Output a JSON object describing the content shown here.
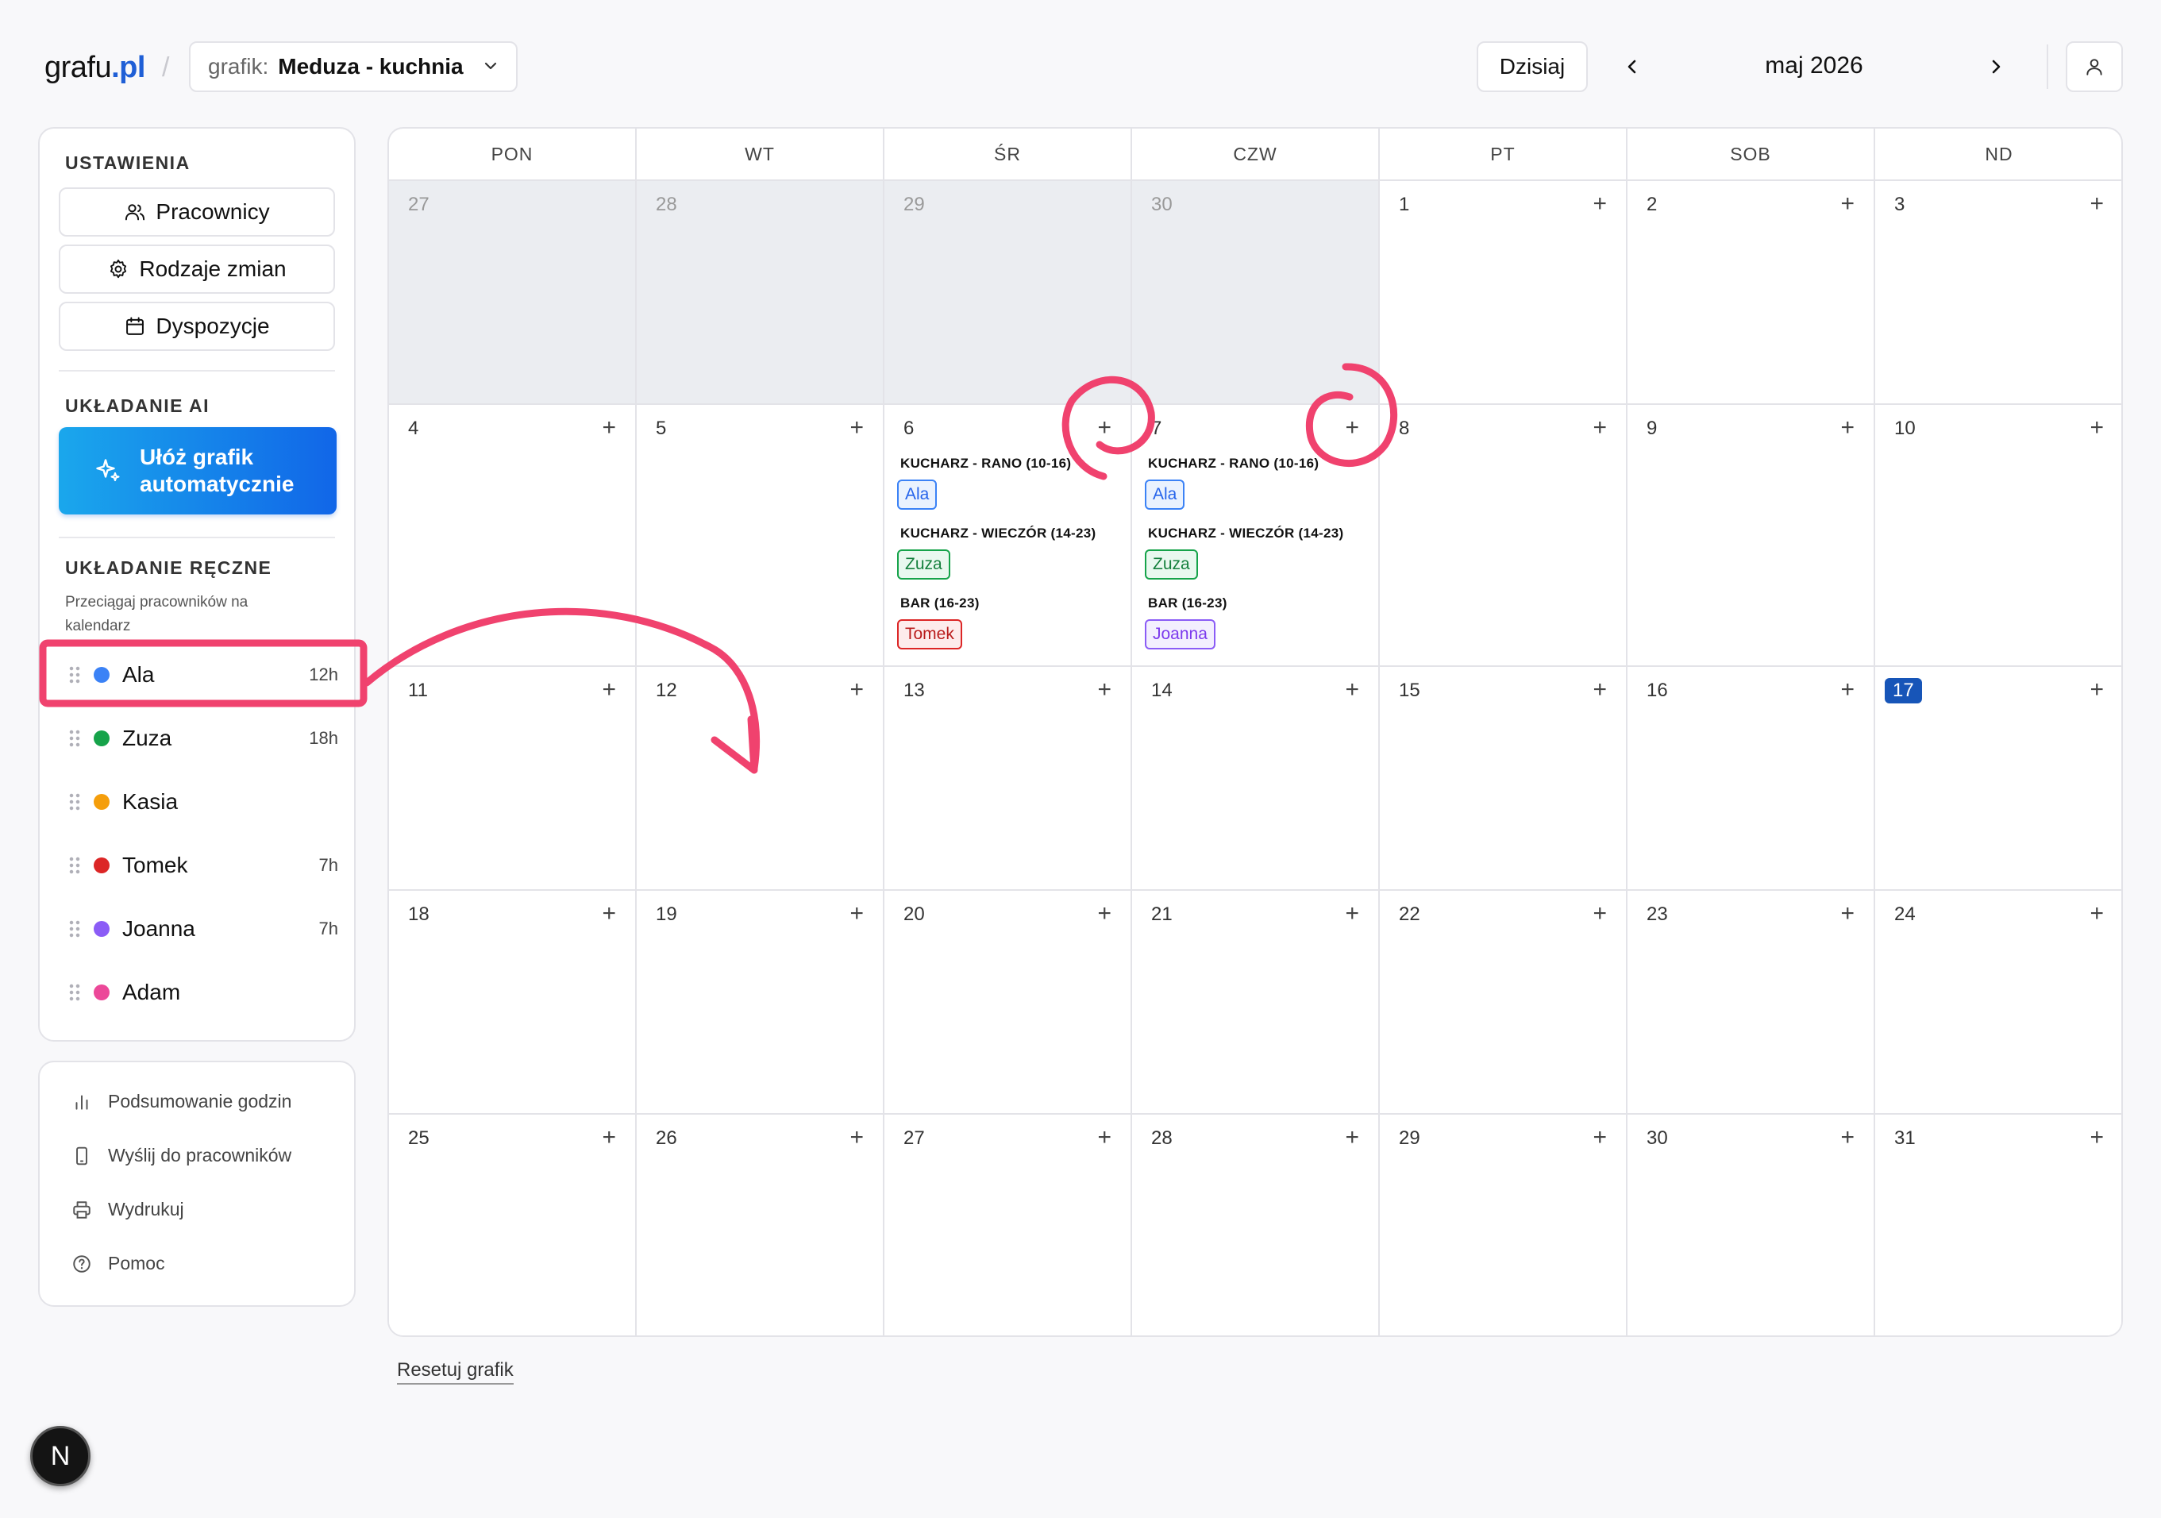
{
  "header": {
    "logo_main": "grafu",
    "logo_tld": ".pl",
    "crumb_sep": "/",
    "schedule_label": "grafik:",
    "schedule_value": "Meduza - kuchnia",
    "today_label": "Dzisiaj",
    "month_label": "maj 2026"
  },
  "sidebar": {
    "settings_title": "USTAWIENIA",
    "settings_buttons": [
      {
        "label": "Pracownicy",
        "icon": "users-icon"
      },
      {
        "label": "Rodzaje zmian",
        "icon": "gear-icon"
      },
      {
        "label": "Dyspozycje",
        "icon": "calendar-icon"
      }
    ],
    "ai_title": "UKŁADANIE AI",
    "ai_button_label": "Ułóż grafik\nautomatycznie",
    "manual_title": "UKŁADANIE RĘCZNE",
    "manual_hint": "Przeciągaj pracowników na kalendarz",
    "employees": [
      {
        "name": "Ala",
        "hours": "12h",
        "color": "#3b82f6"
      },
      {
        "name": "Zuza",
        "hours": "18h",
        "color": "#16a34a"
      },
      {
        "name": "Kasia",
        "hours": "",
        "color": "#f59e0b"
      },
      {
        "name": "Tomek",
        "hours": "7h",
        "color": "#dc2626"
      },
      {
        "name": "Joanna",
        "hours": "7h",
        "color": "#8b5cf6"
      },
      {
        "name": "Adam",
        "hours": "",
        "color": "#ec4899"
      }
    ]
  },
  "bottom_panel": {
    "items": [
      {
        "label": "Podsumowanie godzin",
        "icon": "bar-chart-icon"
      },
      {
        "label": "Wyślij do pracowników",
        "icon": "phone-icon"
      },
      {
        "label": "Wydrukuj",
        "icon": "printer-icon"
      },
      {
        "label": "Pomoc",
        "icon": "help-icon"
      }
    ]
  },
  "calendar": {
    "weekdays": [
      "PON",
      "WT",
      "ŚR",
      "CZW",
      "PT",
      "SOB",
      "ND"
    ],
    "plus_label": "+",
    "weeks": [
      [
        {
          "d": "27",
          "out": true
        },
        {
          "d": "28",
          "out": true
        },
        {
          "d": "29",
          "out": true
        },
        {
          "d": "30",
          "out": true
        },
        {
          "d": "1"
        },
        {
          "d": "2"
        },
        {
          "d": "3"
        }
      ],
      [
        {
          "d": "4"
        },
        {
          "d": "5"
        },
        {
          "d": "6"
        },
        {
          "d": "7"
        },
        {
          "d": "8"
        },
        {
          "d": "9"
        },
        {
          "d": "10"
        }
      ],
      [
        {
          "d": "11"
        },
        {
          "d": "12"
        },
        {
          "d": "13"
        },
        {
          "d": "14"
        },
        {
          "d": "15"
        },
        {
          "d": "16"
        },
        {
          "d": "17",
          "today": true
        }
      ],
      [
        {
          "d": "18"
        },
        {
          "d": "19"
        },
        {
          "d": "20"
        },
        {
          "d": "21"
        },
        {
          "d": "22"
        },
        {
          "d": "23"
        },
        {
          "d": "24"
        }
      ],
      [
        {
          "d": "25"
        },
        {
          "d": "26"
        },
        {
          "d": "27"
        },
        {
          "d": "28"
        },
        {
          "d": "29"
        },
        {
          "d": "30"
        },
        {
          "d": "31"
        }
      ]
    ],
    "shifts": {
      "6": [
        {
          "label": "KUCHARZ - RANO (10-16)",
          "worker": "Ala",
          "color": "#3b82f6",
          "bg": "#eaf2fe",
          "text": "#2563eb"
        },
        {
          "label": "KUCHARZ - WIECZÓR (14-23)",
          "worker": "Zuza",
          "color": "#16a34a",
          "bg": "#e9f8ef",
          "text": "#15803d"
        },
        {
          "label": "BAR (16-23)",
          "worker": "Tomek",
          "color": "#dc2626",
          "bg": "#fdecec",
          "text": "#b91c1c"
        }
      ],
      "7": [
        {
          "label": "KUCHARZ - RANO (10-16)",
          "worker": "Ala",
          "color": "#3b82f6",
          "bg": "#eaf2fe",
          "text": "#2563eb"
        },
        {
          "label": "KUCHARZ - WIECZÓR (14-23)",
          "worker": "Zuza",
          "color": "#16a34a",
          "bg": "#e9f8ef",
          "text": "#15803d"
        },
        {
          "label": "BAR (16-23)",
          "worker": "Joanna",
          "color": "#8b5cf6",
          "bg": "#f3effe",
          "text": "#7c3aed"
        }
      ]
    }
  },
  "footer": {
    "reset_label": "Resetuj grafik",
    "badge_letter": "N"
  },
  "annotations": {
    "color": "#f0426e"
  }
}
